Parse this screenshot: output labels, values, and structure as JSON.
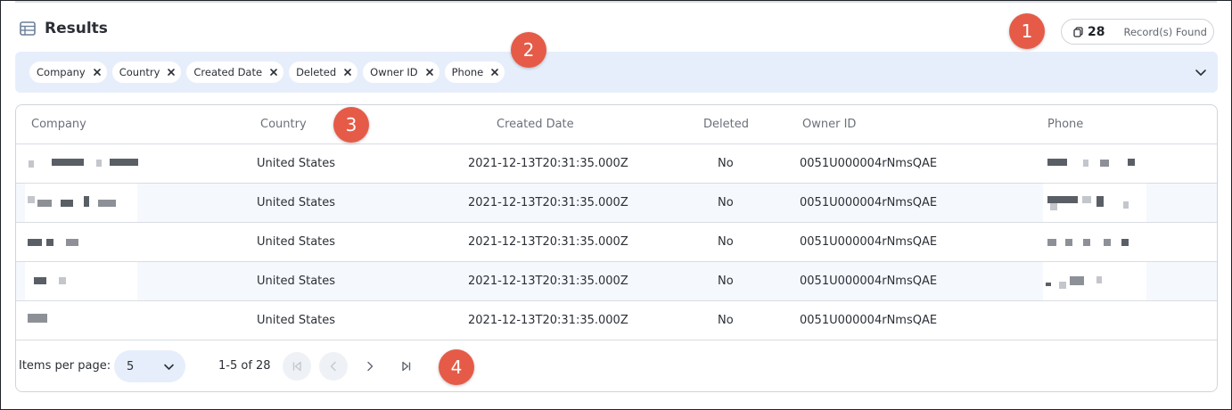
{
  "header": {
    "title": "Results"
  },
  "records": {
    "count": "28",
    "label": "Record(s) Found"
  },
  "badges": [
    "1",
    "2",
    "3",
    "4"
  ],
  "filters": [
    "Company",
    "Country",
    "Created Date",
    "Deleted",
    "Owner ID",
    "Phone"
  ],
  "table": {
    "columns": [
      "Company",
      "Country",
      "Created Date",
      "Deleted",
      "Owner ID",
      "Phone"
    ],
    "rows": [
      {
        "company": "",
        "country": "United States",
        "created": "2021-12-13T20:31:35.000Z",
        "deleted": "No",
        "owner": "0051U000004rNmsQAE",
        "phone": ""
      },
      {
        "company": "",
        "country": "United States",
        "created": "2021-12-13T20:31:35.000Z",
        "deleted": "No",
        "owner": "0051U000004rNmsQAE",
        "phone": ""
      },
      {
        "company": "",
        "country": "United States",
        "created": "2021-12-13T20:31:35.000Z",
        "deleted": "No",
        "owner": "0051U000004rNmsQAE",
        "phone": ""
      },
      {
        "company": "",
        "country": "United States",
        "created": "2021-12-13T20:31:35.000Z",
        "deleted": "No",
        "owner": "0051U000004rNmsQAE",
        "phone": ""
      },
      {
        "company": "",
        "country": "United States",
        "created": "2021-12-13T20:31:35.000Z",
        "deleted": "No",
        "owner": "0051U000004rNmsQAE",
        "phone": ""
      }
    ]
  },
  "pagination": {
    "items_per_page_label": "Items per page:",
    "items_per_page_value": "5",
    "range": "1-5 of 28"
  },
  "colors": {
    "badge": "#e55b48",
    "filter_bg": "#e7eefb",
    "row_alt": "#f5f8fd"
  }
}
